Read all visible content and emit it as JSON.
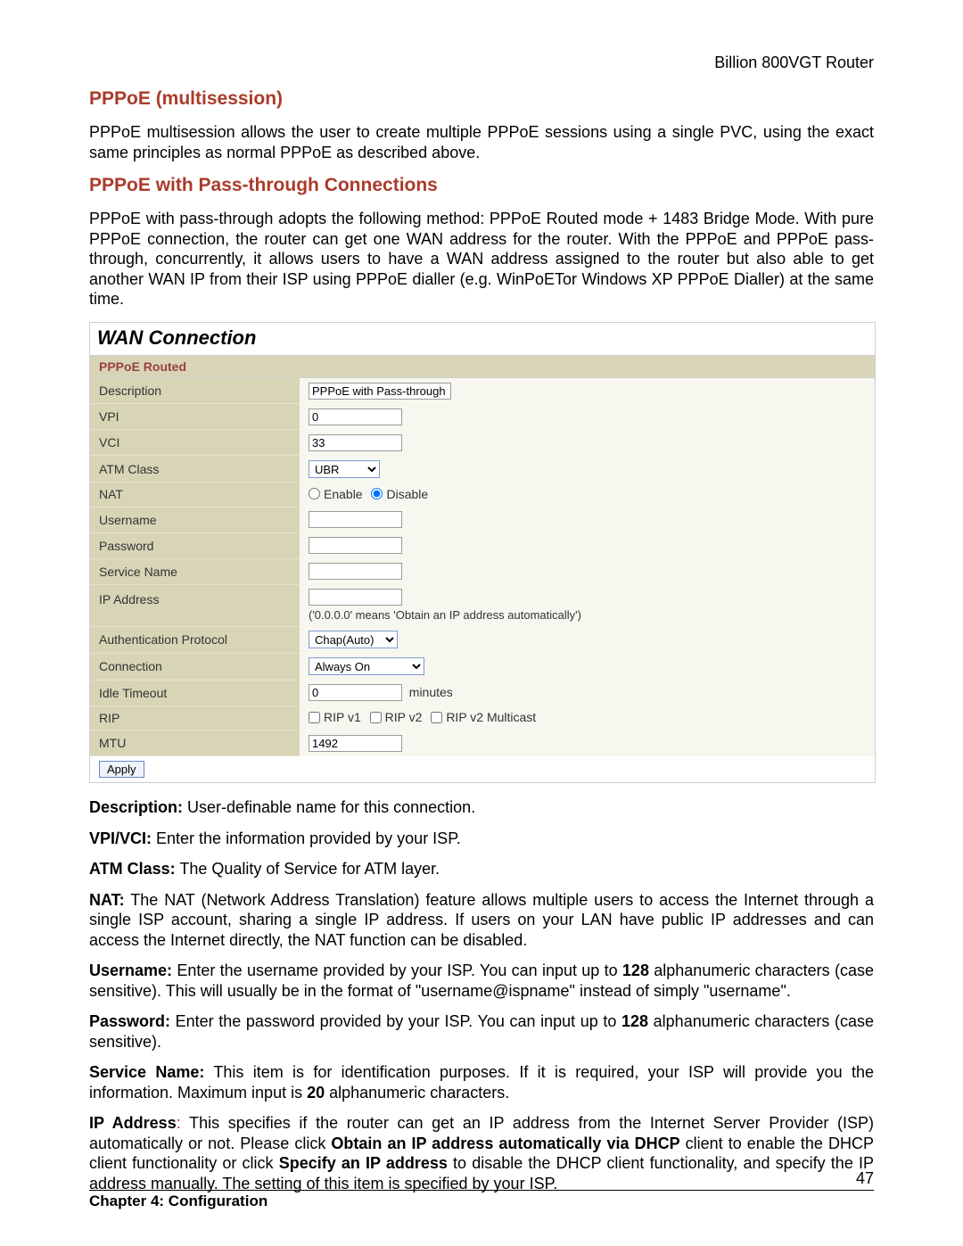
{
  "header": {
    "router": "Billion 800VGT Router"
  },
  "sections": {
    "multisession": {
      "title": "PPPoE (multisession)",
      "para": "PPPoE multisession allows the user to create multiple PPPoE sessions using a single PVC, using the exact same principles as normal PPPoE as described above."
    },
    "passthrough": {
      "title": "PPPoE with Pass-through Connections",
      "para": "PPPoE with pass-through adopts the following method: PPPoE Routed mode + 1483 Bridge Mode. With pure PPPoE connection, the router can get one WAN address for the router.  With the PPPoE and PPPoE pass-through, concurrently, it allows users to have a WAN address assigned to the router but also able to get another WAN IP from their ISP using PPPoE dialler (e.g. WinPoETor Windows XP PPPoE Dialler) at the same time."
    }
  },
  "panel": {
    "title": "WAN Connection",
    "subtitle": "PPPoE Routed",
    "rows": {
      "description": {
        "label": "Description",
        "value": "PPPoE with Pass-through"
      },
      "vpi": {
        "label": "VPI",
        "value": "0"
      },
      "vci": {
        "label": "VCI",
        "value": "33"
      },
      "atm": {
        "label": "ATM Class",
        "value": "UBR"
      },
      "nat": {
        "label": "NAT",
        "enable": "Enable",
        "disable": "Disable"
      },
      "username": {
        "label": "Username",
        "value": ""
      },
      "password": {
        "label": "Password",
        "value": ""
      },
      "service": {
        "label": "Service Name",
        "value": ""
      },
      "ip": {
        "label": "IP Address",
        "value": "",
        "hint": "('0.0.0.0' means 'Obtain an IP address automatically')"
      },
      "auth": {
        "label": "Authentication Protocol",
        "value": "Chap(Auto)"
      },
      "conn": {
        "label": "Connection",
        "value": "Always On"
      },
      "idle": {
        "label": "Idle Timeout",
        "value": "0",
        "suffix": "minutes"
      },
      "rip": {
        "label": "RIP",
        "v1": "RIP v1",
        "v2": "RIP v2",
        "v2m": "RIP v2 Multicast"
      },
      "mtu": {
        "label": "MTU",
        "value": "1492"
      }
    },
    "apply": "Apply"
  },
  "defs": {
    "description": {
      "label": "Description:",
      "text": " User-definable name for this connection."
    },
    "vpivci": {
      "label": "VPI/VCI:",
      "text": " Enter the information provided by your ISP."
    },
    "atm": {
      "label": "ATM Class:",
      "text": " The Quality of Service for ATM layer."
    },
    "nat": {
      "label": "NAT:",
      "text": " The NAT (Network Address Translation) feature allows multiple users to access the Internet through a single ISP account, sharing a single IP address. If users on your LAN have public IP addresses and can access the Internet directly, the NAT function can be disabled."
    },
    "username": {
      "label": "Username:",
      "t1": " Enter the username provided by your ISP. You can input up to ",
      "n": "128",
      "t2": " alphanumeric characters (case sensitive). This will usually be in the format of \"username@ispname\" instead of simply \"username\"."
    },
    "password": {
      "label": "Password:",
      "t1": " Enter the password provided by your ISP. You can input up to ",
      "n": "128",
      "t2": " alphanumeric characters (case sensitive)."
    },
    "service": {
      "label": "Service Name:",
      "t1": " This item is for identification purposes. If it is required, your ISP will provide you the information. Maximum input is ",
      "n": "20",
      "t2": " alphanumeric characters."
    },
    "ip": {
      "label": "IP Address",
      "colon": ":",
      "t1": " This specifies if the router can get an IP address from the Internet Server Provider (ISP) automatically or not. Please click ",
      "b1": "Obtain an IP address automatically via DHCP",
      "t2": " client to enable the DHCP client functionality or click ",
      "b2": "Specify an IP address",
      "t3": " to disable the DHCP client functionality, and specify the IP address manually. The setting of this item is specified by your ISP."
    }
  },
  "footer": {
    "page": "47",
    "chapter": "Chapter 4: Configuration"
  }
}
